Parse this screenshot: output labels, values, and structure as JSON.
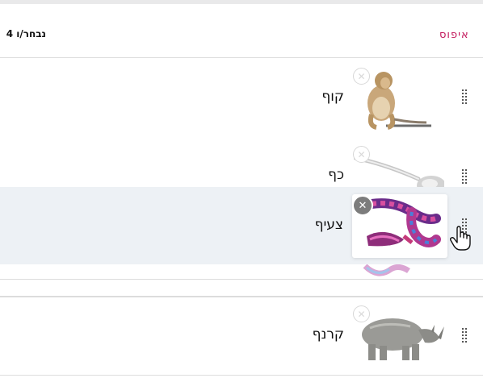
{
  "header": {
    "reset_label": "איפוס",
    "selected_count": "4 נבחר/ו"
  },
  "items": [
    {
      "label": "קוף",
      "image": "monkey-image"
    },
    {
      "label": "כף",
      "image": "spoon-image"
    },
    {
      "label": "צעיף",
      "image": "scarf-image",
      "state": "dragging"
    },
    {
      "label": "קרנף",
      "image": "rhino-image"
    }
  ],
  "icons": {
    "drag": "drag-handle-icon",
    "remove": "close-circle-icon",
    "cursor": "grab-hand-cursor-icon"
  },
  "colors": {
    "accent": "#c2185b",
    "drag_bg": "#edf1f5",
    "divider": "#dcdcdc"
  }
}
